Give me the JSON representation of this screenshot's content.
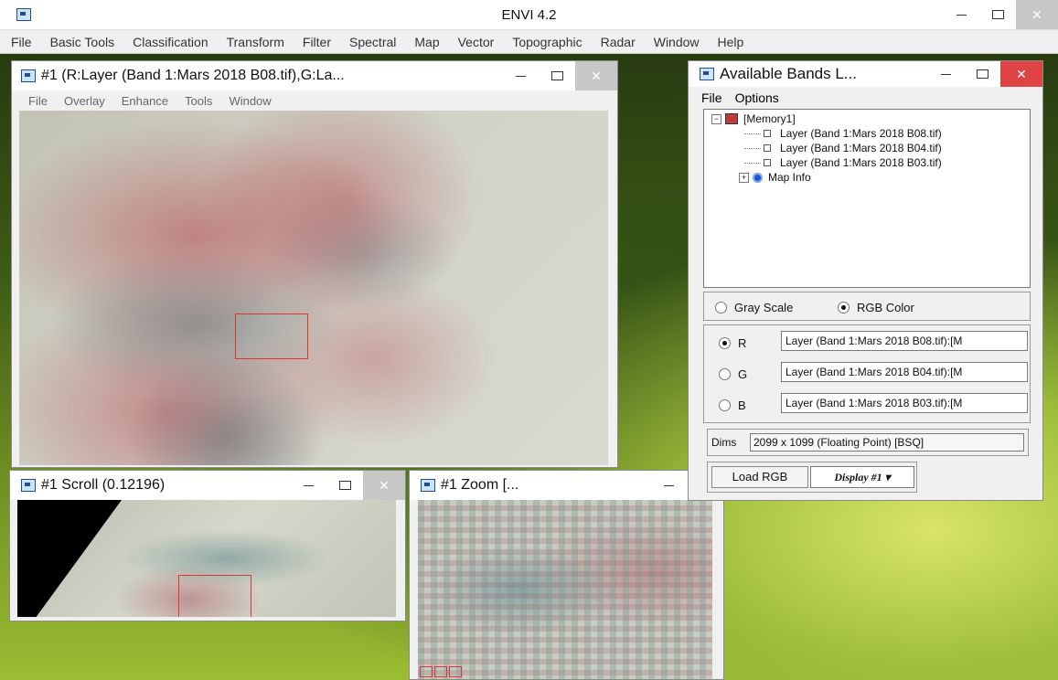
{
  "envi": {
    "title": "ENVI 4.2",
    "menu": [
      "File",
      "Basic Tools",
      "Classification",
      "Transform",
      "Filter",
      "Spectral",
      "Map",
      "Vector",
      "Topographic",
      "Radar",
      "Window",
      "Help"
    ]
  },
  "display_window": {
    "title": "#1 (R:Layer (Band 1:Mars 2018 B08.tif),G:La...",
    "menu": [
      "File",
      "Overlay",
      "Enhance",
      "Tools",
      "Window"
    ]
  },
  "scroll_window": {
    "title": "#1 Scroll (0.12196)"
  },
  "zoom_window": {
    "title": "#1 Zoom [..."
  },
  "bands_window": {
    "title": "Available Bands L...",
    "menu": [
      "File",
      "Options"
    ],
    "tree": {
      "root": "[Memory1]",
      "layers": [
        "Layer (Band 1:Mars 2018 B08.tif)",
        "Layer (Band 1:Mars 2018 B04.tif)",
        "Layer (Band 1:Mars 2018 B03.tif)"
      ],
      "map_info": "Map Info"
    },
    "mode": {
      "gray_scale": "Gray Scale",
      "rgb_color": "RGB Color",
      "selected": "rgb_color"
    },
    "channels": [
      {
        "label": "R",
        "value": "Layer (Band 1:Mars 2018 B08.tif):[M",
        "selected": true
      },
      {
        "label": "G",
        "value": "Layer (Band 1:Mars 2018 B04.tif):[M",
        "selected": false
      },
      {
        "label": "B",
        "value": "Layer (Band 1:Mars 2018 B03.tif):[M",
        "selected": false
      }
    ],
    "dims_label": "Dims",
    "dims_value": "2099 x 1099 (Floating Point) [BSQ]",
    "load_button": "Load RGB",
    "display_button": "Display #1 ▾"
  }
}
